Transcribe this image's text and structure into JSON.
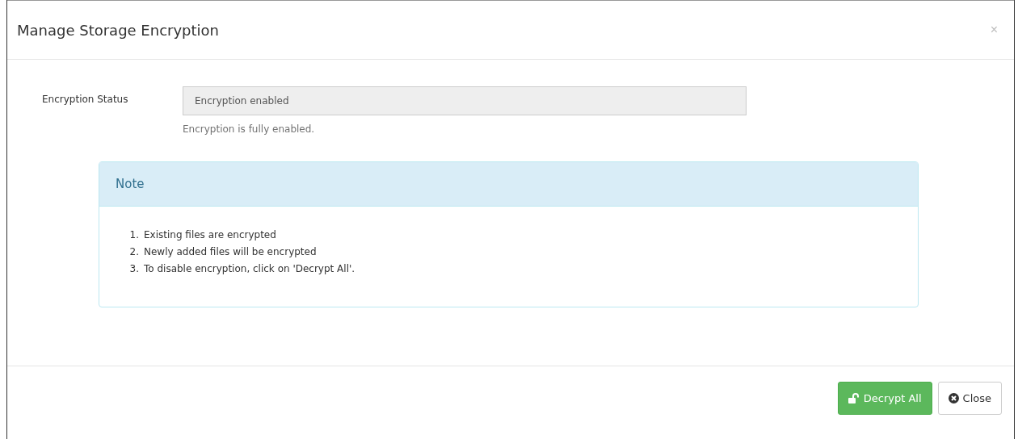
{
  "dialog": {
    "title": "Manage Storage Encryption",
    "close_glyph": "×"
  },
  "field": {
    "label": "Encryption Status",
    "value": "Encryption enabled",
    "disabled": true,
    "help": "Encryption is fully enabled."
  },
  "note": {
    "title": "Note",
    "items": [
      {
        "number": "1.",
        "text": "Existing files are encrypted"
      },
      {
        "number": "2.",
        "text": "Newly added files will be encrypted"
      },
      {
        "number": "3.",
        "text": "To disable encryption, click on 'Decrypt All'."
      }
    ]
  },
  "buttons": [
    {
      "kind": "primary",
      "label": "Decrypt All"
    },
    {
      "kind": "default",
      "label": "Close"
    }
  ]
}
